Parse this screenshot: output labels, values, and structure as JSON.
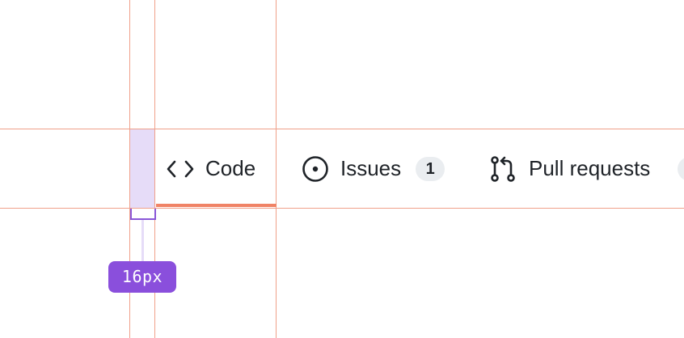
{
  "repo_nav": {
    "tabs": [
      {
        "label": "Code",
        "icon": "code-icon",
        "selected": true
      },
      {
        "label": "Issues",
        "icon": "issue-opened-icon",
        "count": "1"
      },
      {
        "label": "Pull requests",
        "icon": "git-pull-request-icon"
      }
    ]
  },
  "annotation": {
    "padding_label": "16px"
  },
  "colors": {
    "guide": "#f0a08a",
    "padding_highlight": "#e6dcf8",
    "measure_badge": "#8a4fdc",
    "selected_underline": "#f08366",
    "text": "#1f2328",
    "counter_bg": "#eaedf0"
  }
}
